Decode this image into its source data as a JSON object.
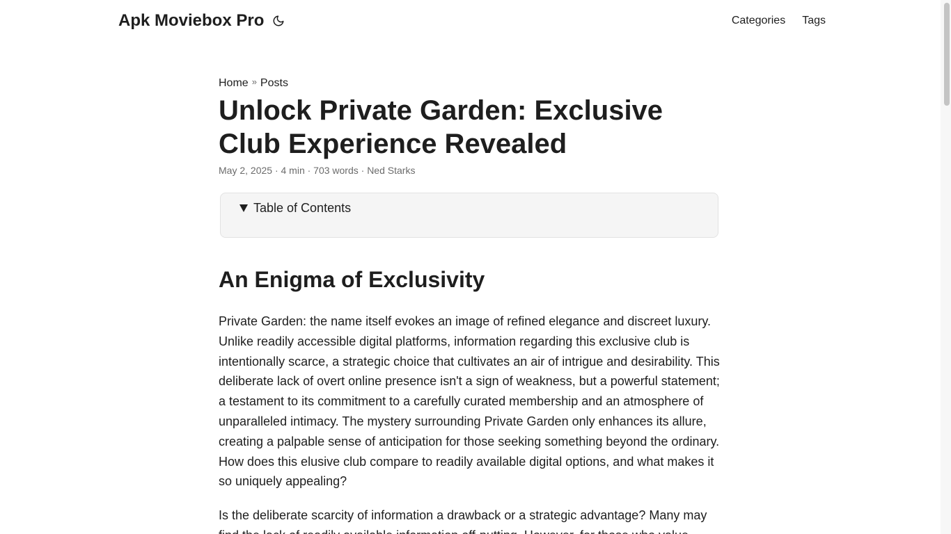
{
  "header": {
    "logo": "Apk Moviebox Pro",
    "theme_icon": "moon-icon",
    "menu": [
      "Categories",
      "Tags"
    ]
  },
  "breadcrumb": {
    "home": "Home",
    "separator": "»",
    "posts": "Posts"
  },
  "post": {
    "title": "Unlock Private Garden: Exclusive Club Experience Revealed",
    "meta": "May 2, 2025 · 4 min · 703 words · Ned Starks",
    "toc_label": "Table of Contents",
    "section_heading": "An Enigma of Exclusivity",
    "paragraphs": [
      "Private Garden: the name itself evokes an image of refined elegance and discreet luxury. Unlike readily accessible digital platforms, information regarding this exclusive club is intentionally scarce, a strategic choice that cultivates an air of intrigue and desirability. This deliberate lack of overt online presence isn't a sign of weakness, but a powerful statement; a testament to its commitment to a carefully curated membership and an atmosphere of unparalleled intimacy. The mystery surrounding Private Garden only enhances its allure, creating a palpable sense of anticipation for those seeking something beyond the ordinary. How does this elusive club compare to readily available digital options, and what makes it so uniquely appealing?",
      "Is the deliberate scarcity of information a drawback or a strategic advantage? Many may find the lack of readily available information off-putting. However, for those who value"
    ]
  }
}
